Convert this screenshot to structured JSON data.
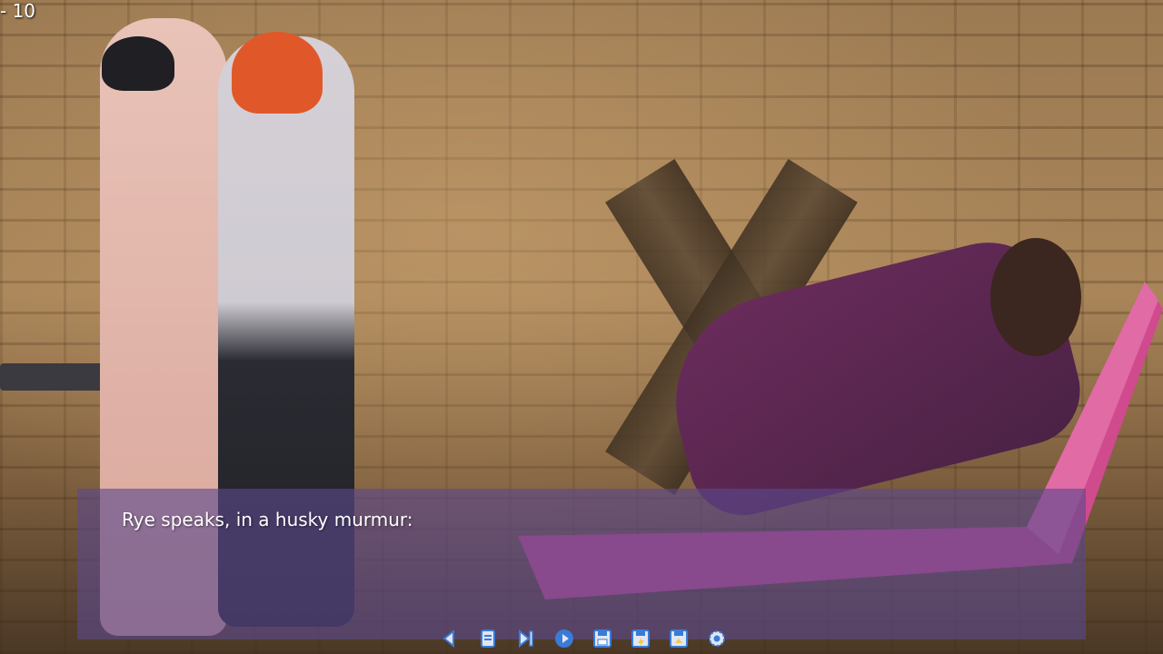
{
  "hud": {
    "counter": "- 10"
  },
  "dialogue": {
    "text": "Rye speaks, in a husky murmur:"
  },
  "quick_menu": [
    {
      "name": "back",
      "icon": "back-icon"
    },
    {
      "name": "history",
      "icon": "history-icon"
    },
    {
      "name": "skip",
      "icon": "skip-icon"
    },
    {
      "name": "auto",
      "icon": "auto-icon"
    },
    {
      "name": "save",
      "icon": "save-icon"
    },
    {
      "name": "quick-save",
      "icon": "quick-save-icon"
    },
    {
      "name": "quick-load",
      "icon": "quick-load-icon"
    },
    {
      "name": "settings",
      "icon": "gear-icon"
    }
  ],
  "colors": {
    "accent": "#3a7bd5",
    "icon_fill": "#dfe6f5",
    "textbox": "#5c488c"
  }
}
